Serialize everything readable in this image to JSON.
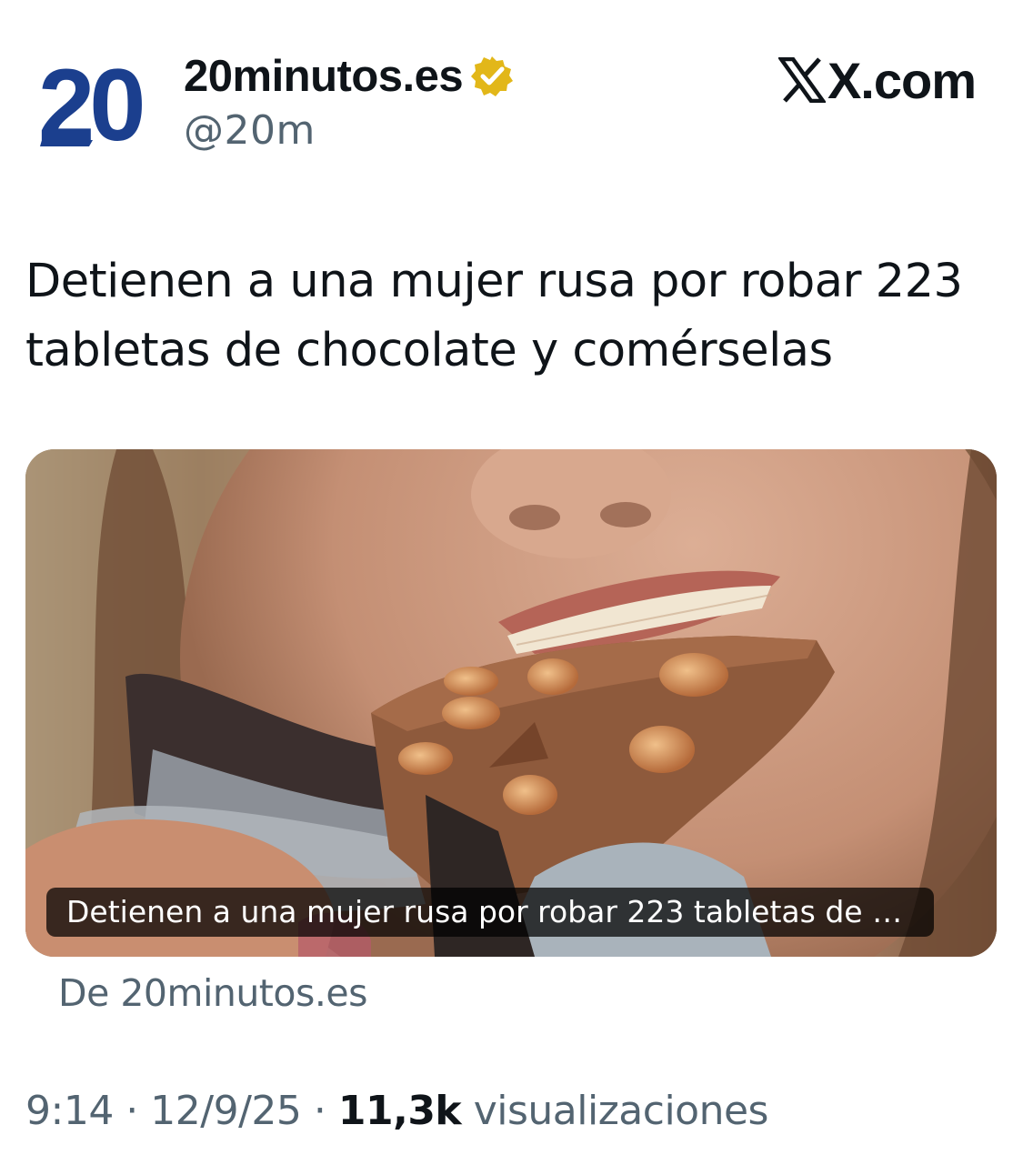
{
  "header": {
    "logo_text": "20",
    "display_name": "20minutos.es",
    "handle": "@20m",
    "brand": "X.com",
    "brand_icon": "x-logo-icon",
    "verified_icon": "verified-badge-icon",
    "verified_color": "#E2B719",
    "logo_color": "#1B3F8E"
  },
  "tweet": {
    "text_line1": "Detienen a una mujer rusa por robar 223",
    "text_line2": "tabletas de chocolate y comérselas"
  },
  "card": {
    "image_icon": "woman-eating-chocolate-photo",
    "caption": "Detienen a una mujer rusa por robar 223 tabletas de ch…",
    "source": "De 20minutos.es"
  },
  "meta": {
    "time": "9:14",
    "separator": " · ",
    "date": "12/9/25",
    "views_count": "11,3k",
    "views_label": "visualizaciones"
  }
}
